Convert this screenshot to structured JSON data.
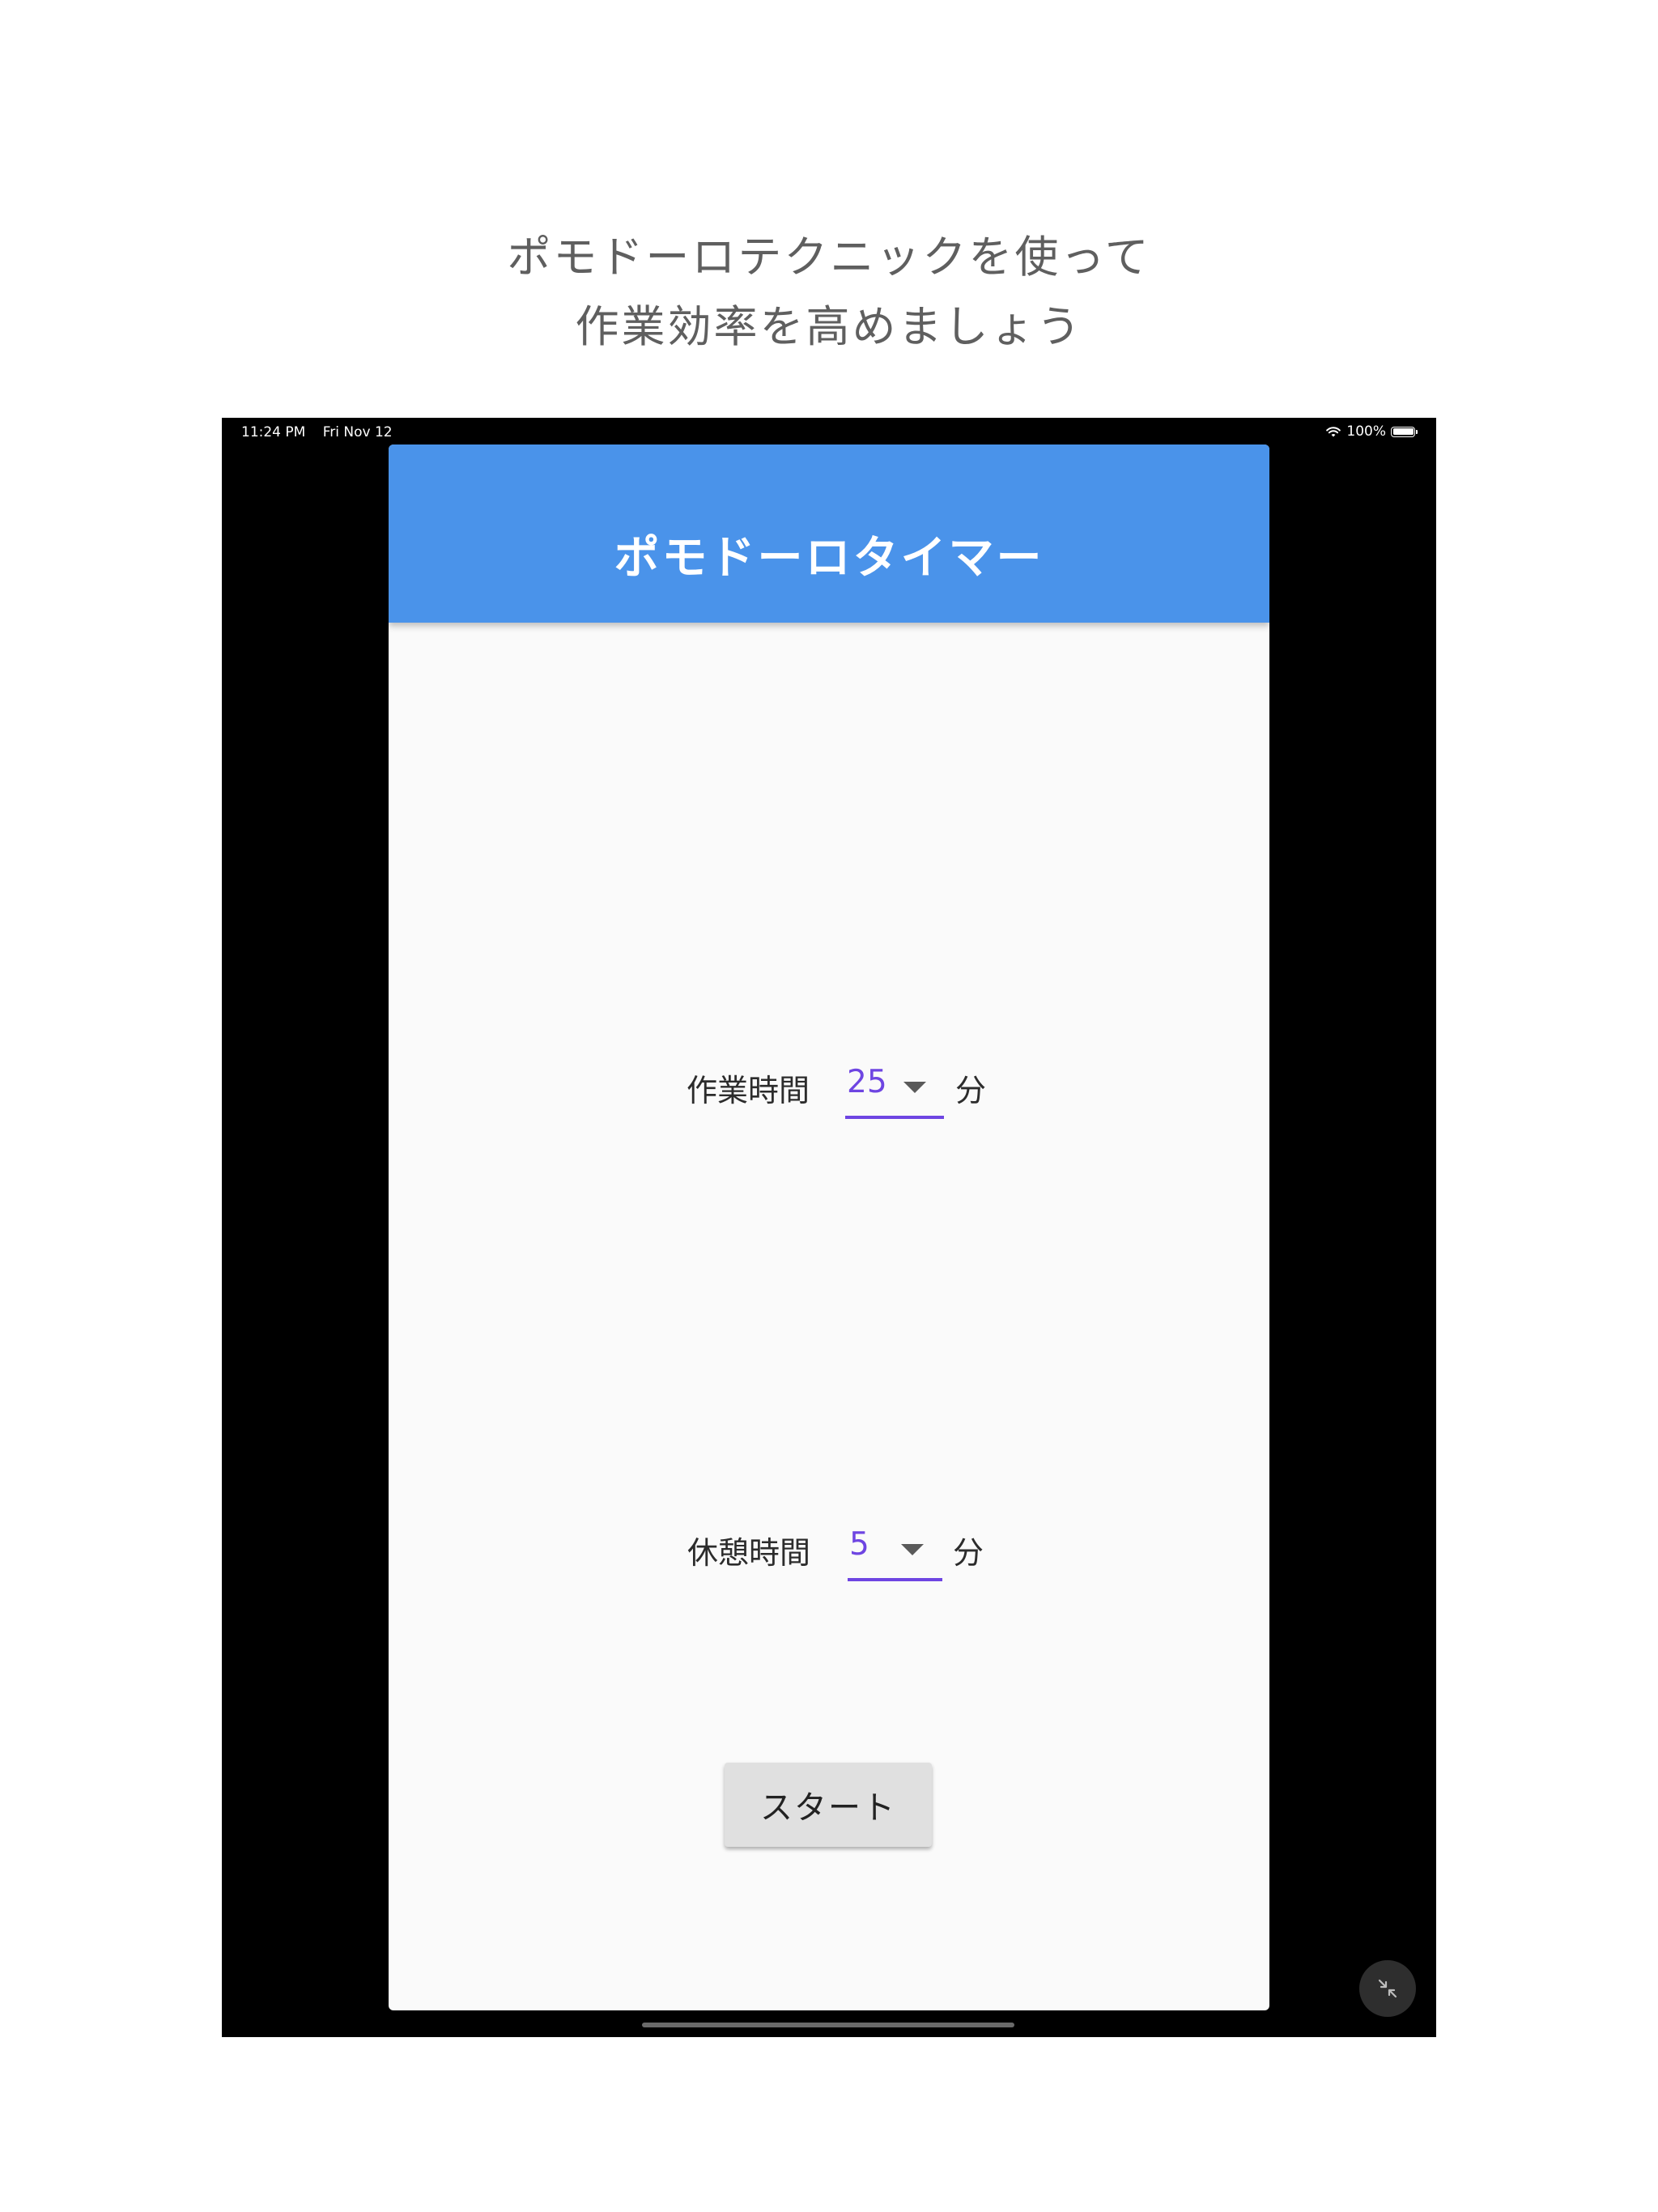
{
  "promo": {
    "line1": "ポモドーロテクニックを使って",
    "line2": "作業効率を高めましょう"
  },
  "status_bar": {
    "time": "11:24 PM",
    "date": "Fri Nov 12",
    "battery": "100%",
    "battery_level": 1.0
  },
  "app_bar": {
    "title": "ポモドーロタイマー"
  },
  "work_time": {
    "label": "作業時間",
    "value": "25",
    "unit": "分"
  },
  "break_time": {
    "label": "休憩時間",
    "value": "5",
    "unit": "分"
  },
  "start_button": {
    "label": "スタート"
  },
  "colors": {
    "app_bar": "#4a93ea",
    "accent": "#6e45e2",
    "background": "#fafafa",
    "button": "#e0e0e0"
  },
  "icons": {
    "wifi": "wifi-icon",
    "battery": "battery-icon",
    "dropdown": "arrow-drop-down-icon",
    "exit_fullscreen": "exit-fullscreen-icon"
  }
}
